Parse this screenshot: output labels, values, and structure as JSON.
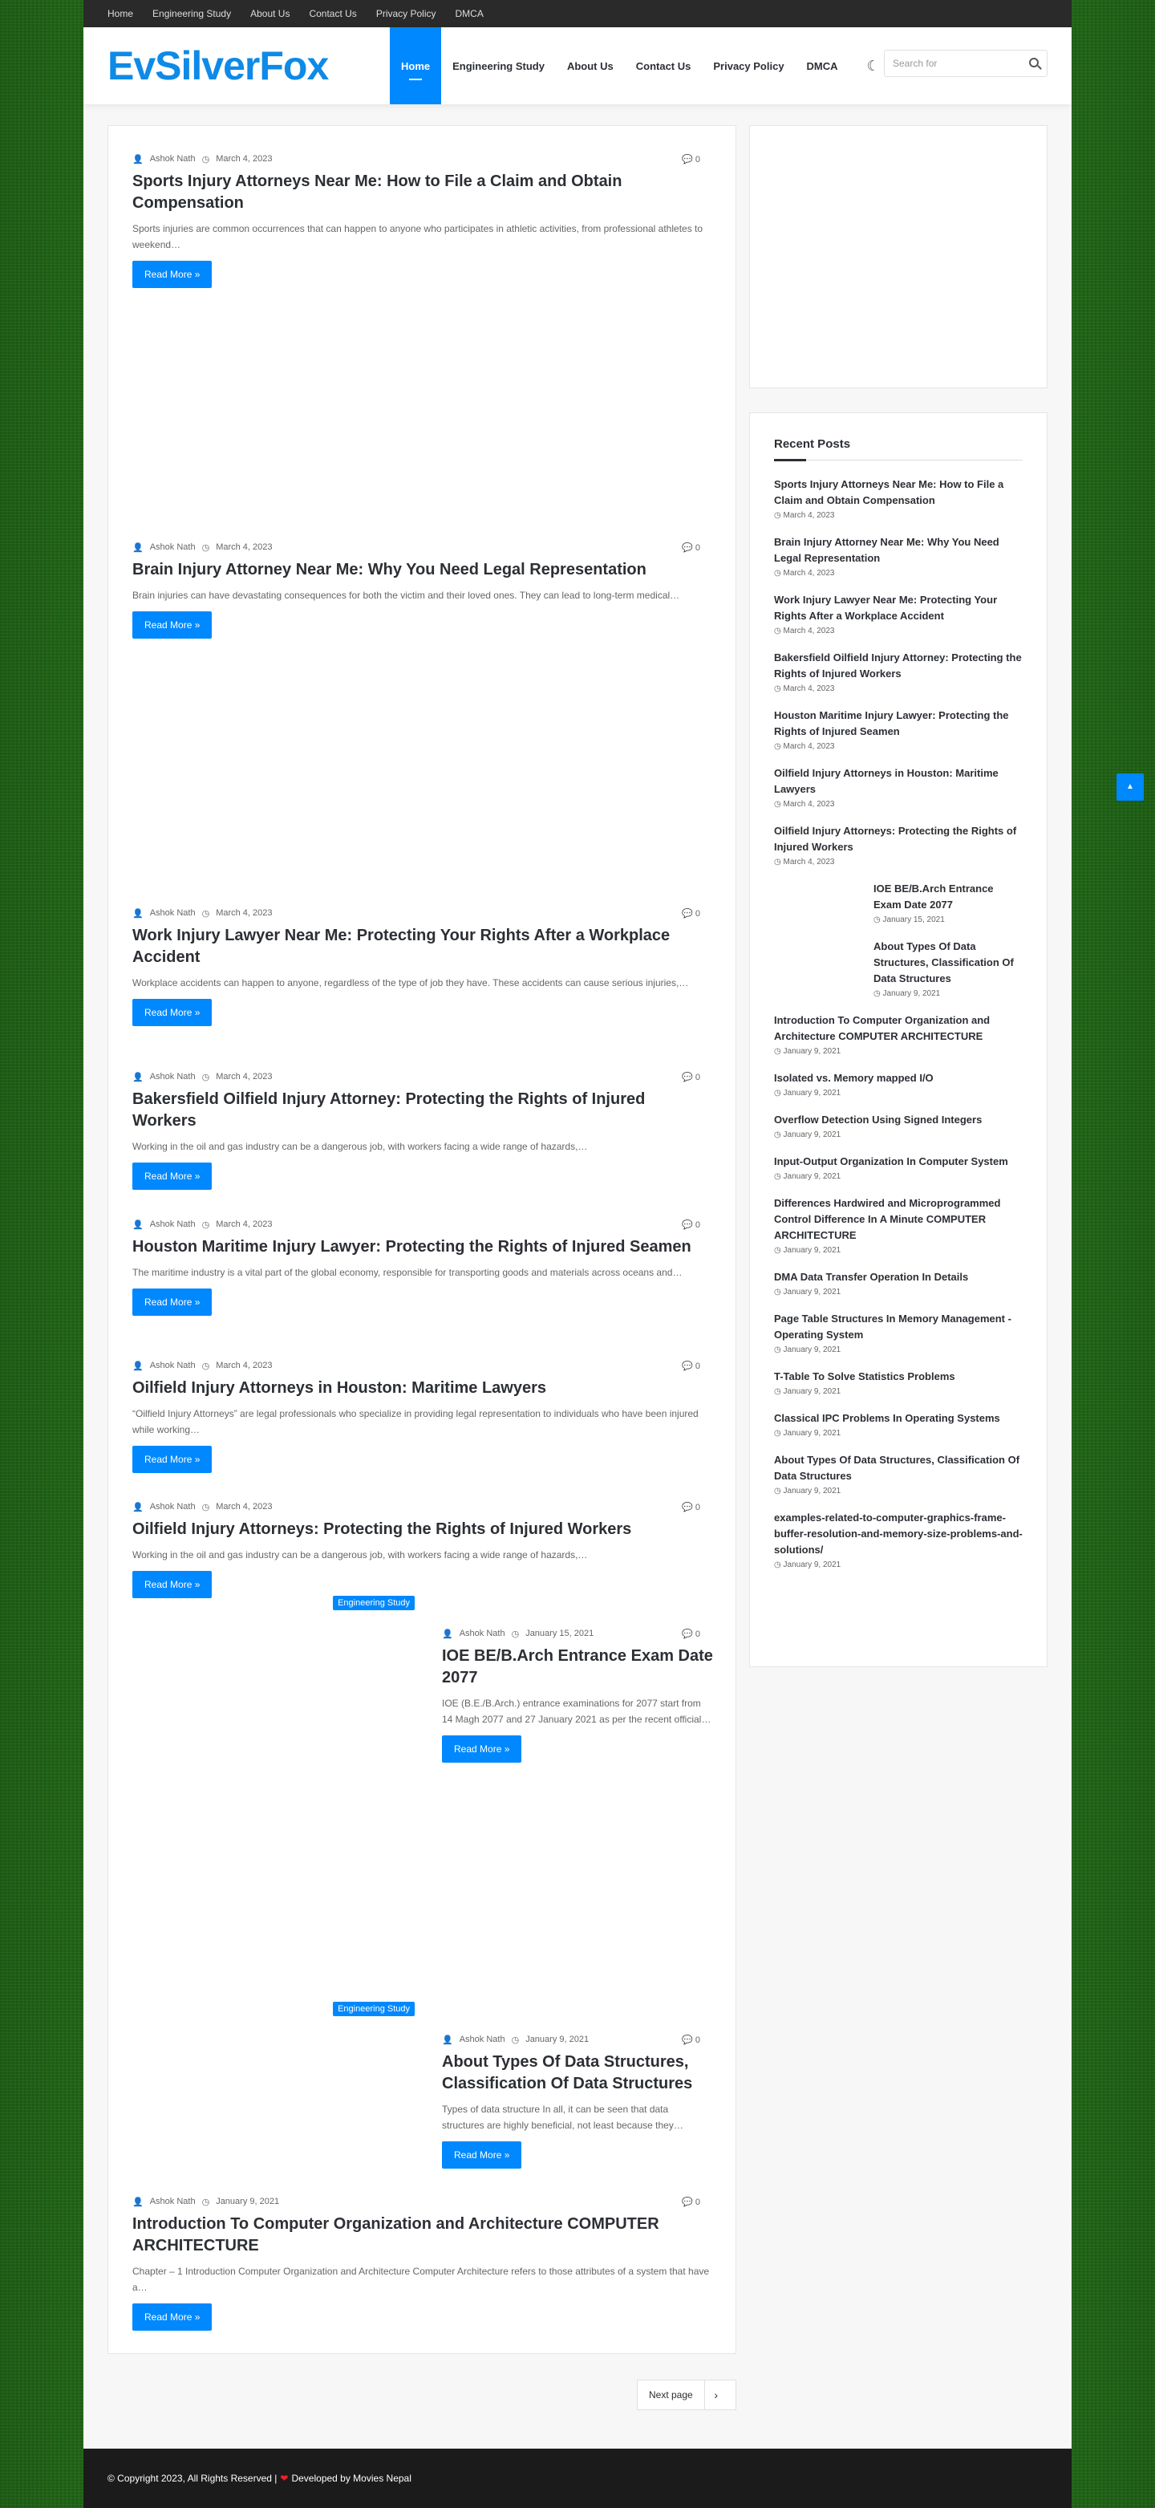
{
  "topnav": [
    "Home",
    "Engineering Study",
    "About Us",
    "Contact Us",
    "Privacy Policy",
    "DMCA"
  ],
  "logo": "EvSilverFox",
  "mainnav": [
    "Home",
    "Engineering Study",
    "About Us",
    "Contact Us",
    "Privacy Policy",
    "DMCA"
  ],
  "search": {
    "placeholder": "Search for"
  },
  "posts": [
    {
      "author": "Ashok Nath",
      "date": "March 4, 2023",
      "comments": "0",
      "title": "Sports Injury Attorneys Near Me: How to File a Claim and Obtain Compensation",
      "excerpt": "Sports injuries are common occurrences that can happen to anyone who participates in athletic activities, from professional athletes to weekend…",
      "button": "Read More »"
    },
    {
      "author": "Ashok Nath",
      "date": "March 4, 2023",
      "comments": "0",
      "title": "Brain Injury Attorney Near Me: Why You Need Legal Representation",
      "excerpt": "Brain injuries can have devastating consequences for both the victim and their loved ones. They can lead to long-term medical…",
      "button": "Read More »"
    },
    {
      "author": "Ashok Nath",
      "date": "March 4, 2023",
      "comments": "0",
      "title": "Work Injury Lawyer Near Me: Protecting Your Rights After a Workplace Accident",
      "excerpt": "Workplace accidents can happen to anyone, regardless of the type of job they have. These accidents can cause serious injuries,…",
      "button": "Read More »"
    },
    {
      "author": "Ashok Nath",
      "date": "March 4, 2023",
      "comments": "0",
      "title": "Bakersfield Oilfield Injury Attorney: Protecting the Rights of Injured Workers",
      "excerpt": "Working in the oil and gas industry can be a dangerous job, with workers facing a wide range of hazards,…",
      "button": "Read More »"
    },
    {
      "author": "Ashok Nath",
      "date": "March 4, 2023",
      "comments": "0",
      "title": "Houston Maritime Injury Lawyer: Protecting the Rights of Injured Seamen",
      "excerpt": "The maritime industry is a vital part of the global economy, responsible for transporting goods and materials across oceans and…",
      "button": "Read More »"
    },
    {
      "author": "Ashok Nath",
      "date": "March 4, 2023",
      "comments": "0",
      "title": "Oilfield Injury Attorneys in Houston: Maritime Lawyers",
      "excerpt": "“Oilfield Injury Attorneys” are legal professionals who specialize in providing legal representation to individuals who have been injured while working…",
      "button": "Read More »"
    },
    {
      "author": "Ashok Nath",
      "date": "March 4, 2023",
      "comments": "0",
      "title": "Oilfield Injury Attorneys: Protecting the Rights of Injured Workers",
      "excerpt": "Working in the oil and gas industry can be a dangerous job, with workers facing a wide range of hazards,…",
      "button": "Read More »"
    },
    {
      "category": "Engineering Study",
      "author": "Ashok Nath",
      "date": "January 15, 2021",
      "comments": "0",
      "title": "IOE BE/B.Arch Entrance Exam Date 2077",
      "excerpt": "IOE (B.E./B.Arch.) entrance examinations for 2077 start from 14 Magh 2077 and  27 January 2021 as per the recent official…",
      "button": "Read More »"
    },
    {
      "category": "Engineering Study",
      "author": "Ashok Nath",
      "date": "January 9, 2021",
      "comments": "0",
      "title": "About Types Of Data Structures, Classification Of Data Structures",
      "excerpt": "Types of data structure In all, it can be seen that data structures are highly beneficial, not least because they…",
      "button": "Read More »"
    },
    {
      "author": "Ashok Nath",
      "date": "January 9, 2021",
      "comments": "0",
      "title": "Introduction To Computer Organization and Architecture COMPUTER ARCHITECTURE",
      "excerpt": "Chapter – 1 Introduction Computer Organization and Architecture Computer Architecture refers to those attributes of a system that have a…",
      "button": "Read More »"
    }
  ],
  "pagination": {
    "next": "Next page"
  },
  "sidebar": {
    "title": "Recent Posts",
    "items": [
      {
        "title": "Sports Injury Attorneys Near Me: How to File a Claim and Obtain Compensation",
        "date": "March 4, 2023"
      },
      {
        "title": "Brain Injury Attorney Near Me: Why You Need Legal Representation",
        "date": "March 4, 2023"
      },
      {
        "title": "Work Injury Lawyer Near Me: Protecting Your Rights After a Workplace Accident",
        "date": "March 4, 2023"
      },
      {
        "title": "Bakersfield Oilfield Injury Attorney: Protecting the Rights of Injured Workers",
        "date": "March 4, 2023"
      },
      {
        "title": "Houston Maritime Injury Lawyer: Protecting the Rights of Injured Seamen",
        "date": "March 4, 2023"
      },
      {
        "title": "Oilfield Injury Attorneys in Houston: Maritime Lawyers",
        "date": "March 4, 2023"
      },
      {
        "title": "Oilfield Injury Attorneys: Protecting the Rights of Injured Workers",
        "date": "March 4, 2023"
      },
      {
        "title": "IOE BE/B.Arch Entrance Exam Date 2077",
        "date": "January 15, 2021"
      },
      {
        "title": "About Types Of Data Structures, Classification Of Data Structures",
        "date": "January 9, 2021"
      },
      {
        "title": "Introduction To Computer Organization and Architecture COMPUTER ARCHITECTURE",
        "date": "January 9, 2021"
      },
      {
        "title": "Isolated vs. Memory mapped I/O",
        "date": "January 9, 2021"
      },
      {
        "title": "Overflow Detection Using Signed Integers",
        "date": "January 9, 2021"
      },
      {
        "title": "Input-Output Organization In Computer System",
        "date": "January 9, 2021"
      },
      {
        "title": "Differences Hardwired and Microprogrammed Control Difference In A Minute COMPUTER ARCHITECTURE",
        "date": "January 9, 2021"
      },
      {
        "title": "DMA Data Transfer Operation In Details",
        "date": "January 9, 2021"
      },
      {
        "title": "Page Table Structures In Memory Management -Operating System",
        "date": "January 9, 2021"
      },
      {
        "title": "T-Table To Solve Statistics Problems",
        "date": "January 9, 2021"
      },
      {
        "title": "Classical IPC Problems In Operating Systems",
        "date": "January 9, 2021"
      },
      {
        "title": "About Types Of Data Structures, Classification Of Data Structures",
        "date": "January 9, 2021"
      },
      {
        "title": "examples-related-to-computer-graphics-frame-buffer-resolution-and-memory-size-problems-and-solutions/",
        "date": "January 9, 2021"
      }
    ]
  },
  "footer": {
    "copyright": "© Copyright 2023, All Rights Reserved  |",
    "developed": "Developed by Movies Nepal"
  },
  "colors": {
    "accent": "#0088ff",
    "logo": "#0e8ae7"
  }
}
